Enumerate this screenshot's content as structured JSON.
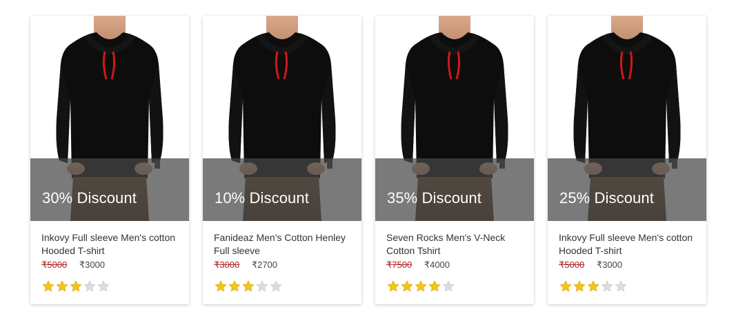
{
  "products": [
    {
      "discount_label": "30% Discount",
      "name": "Inkovy Full sleeve Men's cotton Hooded T-shirt",
      "old_price": "₹5000",
      "new_price": "₹3000",
      "rating": 3,
      "rating_max": 5
    },
    {
      "discount_label": "10% Discount",
      "name": "Fanideaz Men's Cotton Henley Full sleeve",
      "old_price": "₹3000",
      "new_price": "₹2700",
      "rating": 3,
      "rating_max": 5
    },
    {
      "discount_label": "35% Discount",
      "name": "Seven Rocks Men's V-Neck Cotton Tshirt",
      "old_price": "₹7500",
      "new_price": "₹4000",
      "rating": 4,
      "rating_max": 5
    },
    {
      "discount_label": "25% Discount",
      "name": "Inkovy Full sleeve Men's cotton Hooded T-shirt",
      "old_price": "₹5000",
      "new_price": "₹3000",
      "rating": 3,
      "rating_max": 5
    }
  ],
  "colors": {
    "star_filled": "#f5c518",
    "star_filled_stroke": "#e0a800",
    "star_empty": "#dddddd",
    "old_price": "#b22222",
    "overlay": "#464646"
  },
  "icons": {
    "star": "star-icon",
    "product_image": "hoodie-model-image"
  }
}
